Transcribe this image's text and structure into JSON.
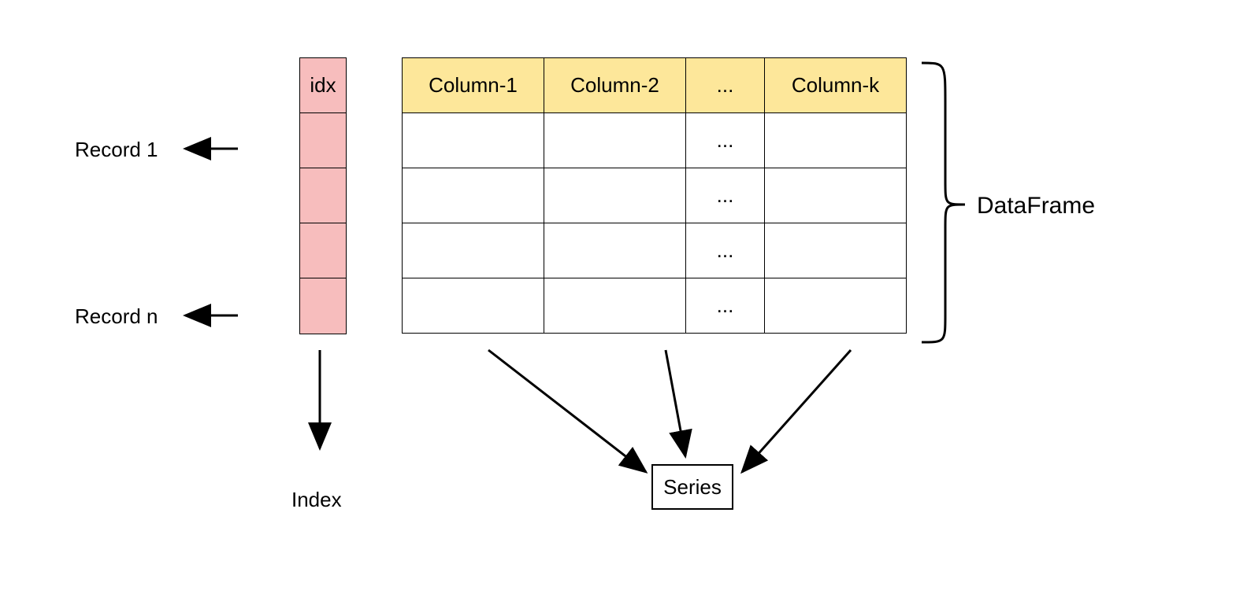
{
  "index": {
    "header": "idx",
    "label_below": "Index"
  },
  "records": {
    "first": "Record 1",
    "last": "Record n"
  },
  "columns": {
    "headers": [
      "Column-1",
      "Column-2",
      "...",
      "Column-k"
    ],
    "row_ellipsis": "..."
  },
  "dataframe_label": "DataFrame",
  "series_label": "Series"
}
